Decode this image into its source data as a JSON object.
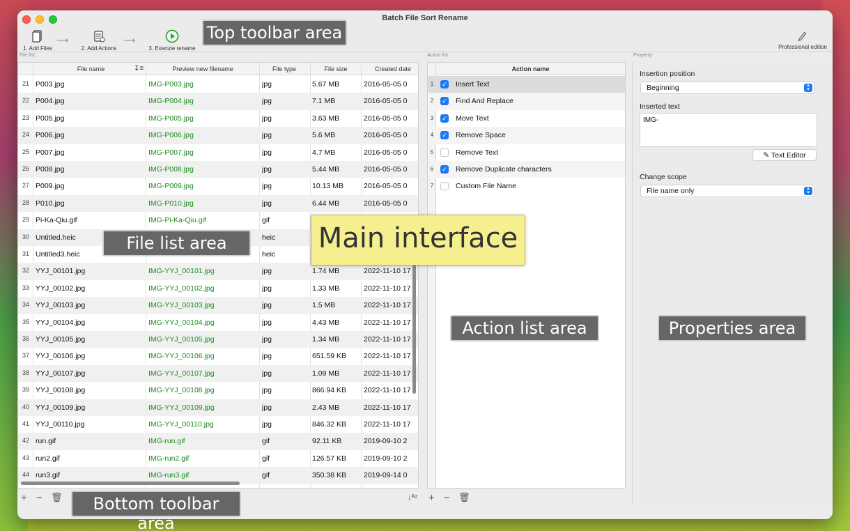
{
  "window": {
    "title": "Batch File Sort Rename"
  },
  "toolbar": {
    "add_files": "1. Add Files",
    "add_actions": "2. Add Actions",
    "execute": "3. Execute rename",
    "edition": "Professional edition"
  },
  "panels": {
    "file_list_label": "File list:",
    "action_list_label": "Action list:",
    "property_label": "Property:"
  },
  "file_table": {
    "columns": [
      "File name",
      "Preview new filename",
      "File type",
      "File size",
      "Created date"
    ],
    "rows": [
      {
        "num": "21",
        "name": "P003.jpg",
        "preview": "IMG-P003.jpg",
        "type": "jpg",
        "size": "5.67 MB",
        "date": "2016-05-05 0"
      },
      {
        "num": "22",
        "name": "P004.jpg",
        "preview": "IMG-P004.jpg",
        "type": "jpg",
        "size": "7.1 MB",
        "date": "2016-05-05 0"
      },
      {
        "num": "23",
        "name": "P005.jpg",
        "preview": "IMG-P005.jpg",
        "type": "jpg",
        "size": "3.63 MB",
        "date": "2016-05-05 0"
      },
      {
        "num": "24",
        "name": "P006.jpg",
        "preview": "IMG-P006.jpg",
        "type": "jpg",
        "size": "5.6 MB",
        "date": "2016-05-05 0"
      },
      {
        "num": "25",
        "name": "P007.jpg",
        "preview": "IMG-P007.jpg",
        "type": "jpg",
        "size": "4.7 MB",
        "date": "2016-05-05 0"
      },
      {
        "num": "26",
        "name": "P008.jpg",
        "preview": "IMG-P008.jpg",
        "type": "jpg",
        "size": "5.44 MB",
        "date": "2016-05-05 0"
      },
      {
        "num": "27",
        "name": "P009.jpg",
        "preview": "IMG-P009.jpg",
        "type": "jpg",
        "size": "10.13 MB",
        "date": "2016-05-05 0"
      },
      {
        "num": "28",
        "name": "P010.jpg",
        "preview": "IMG-P010.jpg",
        "type": "jpg",
        "size": "6.44 MB",
        "date": "2016-05-05 0"
      },
      {
        "num": "29",
        "name": "Pi-Ka-Qiu.gif",
        "preview": "IMG-Pi-Ka-Qiu.gif",
        "type": "gif",
        "size": "",
        "date": ""
      },
      {
        "num": "30",
        "name": "Untitled.heic",
        "preview": "",
        "type": "heic",
        "size": "",
        "date": ""
      },
      {
        "num": "31",
        "name": "Untitled3.heic",
        "preview": "",
        "type": "heic",
        "size": "",
        "date": ""
      },
      {
        "num": "32",
        "name": "YYJ_00101.jpg",
        "preview": "IMG-YYJ_00101.jpg",
        "type": "jpg",
        "size": "1.74 MB",
        "date": "2022-11-10 17"
      },
      {
        "num": "33",
        "name": "YYJ_00102.jpg",
        "preview": "IMG-YYJ_00102.jpg",
        "type": "jpg",
        "size": "1.33 MB",
        "date": "2022-11-10 17"
      },
      {
        "num": "34",
        "name": "YYJ_00103.jpg",
        "preview": "IMG-YYJ_00103.jpg",
        "type": "jpg",
        "size": "1.5 MB",
        "date": "2022-11-10 17"
      },
      {
        "num": "35",
        "name": "YYJ_00104.jpg",
        "preview": "IMG-YYJ_00104.jpg",
        "type": "jpg",
        "size": "4.43 MB",
        "date": "2022-11-10 17"
      },
      {
        "num": "36",
        "name": "YYJ_00105.jpg",
        "preview": "IMG-YYJ_00105.jpg",
        "type": "jpg",
        "size": "1.34 MB",
        "date": "2022-11-10 17"
      },
      {
        "num": "37",
        "name": "YYJ_00106.jpg",
        "preview": "IMG-YYJ_00106.jpg",
        "type": "jpg",
        "size": "651.59 KB",
        "date": "2022-11-10 17"
      },
      {
        "num": "38",
        "name": "YYJ_00107.jpg",
        "preview": "IMG-YYJ_00107.jpg",
        "type": "jpg",
        "size": "1.09 MB",
        "date": "2022-11-10 17"
      },
      {
        "num": "39",
        "name": "YYJ_00108.jpg",
        "preview": "IMG-YYJ_00108.jpg",
        "type": "jpg",
        "size": "866.94 KB",
        "date": "2022-11-10 17"
      },
      {
        "num": "40",
        "name": "YYJ_00109.jpg",
        "preview": "IMG-YYJ_00109.jpg",
        "type": "jpg",
        "size": "2.43 MB",
        "date": "2022-11-10 17"
      },
      {
        "num": "41",
        "name": "YYJ_00110.jpg",
        "preview": "IMG-YYJ_00110.jpg",
        "type": "jpg",
        "size": "846.32 KB",
        "date": "2022-11-10 17"
      },
      {
        "num": "42",
        "name": "run.gif",
        "preview": "IMG-run.gif",
        "type": "gif",
        "size": "92.11 KB",
        "date": "2019-09-10 2"
      },
      {
        "num": "43",
        "name": "run2.gif",
        "preview": "IMG-run2.gif",
        "type": "gif",
        "size": "126.57 KB",
        "date": "2019-09-10 2"
      },
      {
        "num": "44",
        "name": "run3.gif",
        "preview": "IMG-run3.gif",
        "type": "gif",
        "size": "350.38 KB",
        "date": "2019-09-14 0"
      }
    ]
  },
  "action_table": {
    "header": "Action name",
    "rows": [
      {
        "num": "1",
        "label": "Insert Text",
        "checked": true
      },
      {
        "num": "2",
        "label": "Find And Replace",
        "checked": true
      },
      {
        "num": "3",
        "label": "Move Text",
        "checked": true
      },
      {
        "num": "4",
        "label": "Remove Space",
        "checked": true
      },
      {
        "num": "5",
        "label": "Remove Text",
        "checked": false
      },
      {
        "num": "6",
        "label": "Remove Duplicate characters",
        "checked": true
      },
      {
        "num": "7",
        "label": "Custom File Name",
        "checked": false
      }
    ]
  },
  "properties": {
    "insertion_position_label": "Insertion position",
    "insertion_position_value": "Beginning",
    "inserted_text_label": "Inserted text",
    "inserted_text_value": "IMG-",
    "text_editor_button": "Text Editor",
    "change_scope_label": "Change scope",
    "change_scope_value": "File name only"
  },
  "callouts": {
    "top_toolbar": "Top toolbar area",
    "file_list": "File list area",
    "main": "Main interface",
    "action_list": "Action list area",
    "properties": "Properties area",
    "bottom_toolbar": "Bottom toolbar area"
  },
  "colors": {
    "accent": "#1f7aef",
    "preview_green": "#1e8a1e",
    "callout_bg": "#5a5a5a",
    "main_callout_bg": "#f6ef8f"
  }
}
